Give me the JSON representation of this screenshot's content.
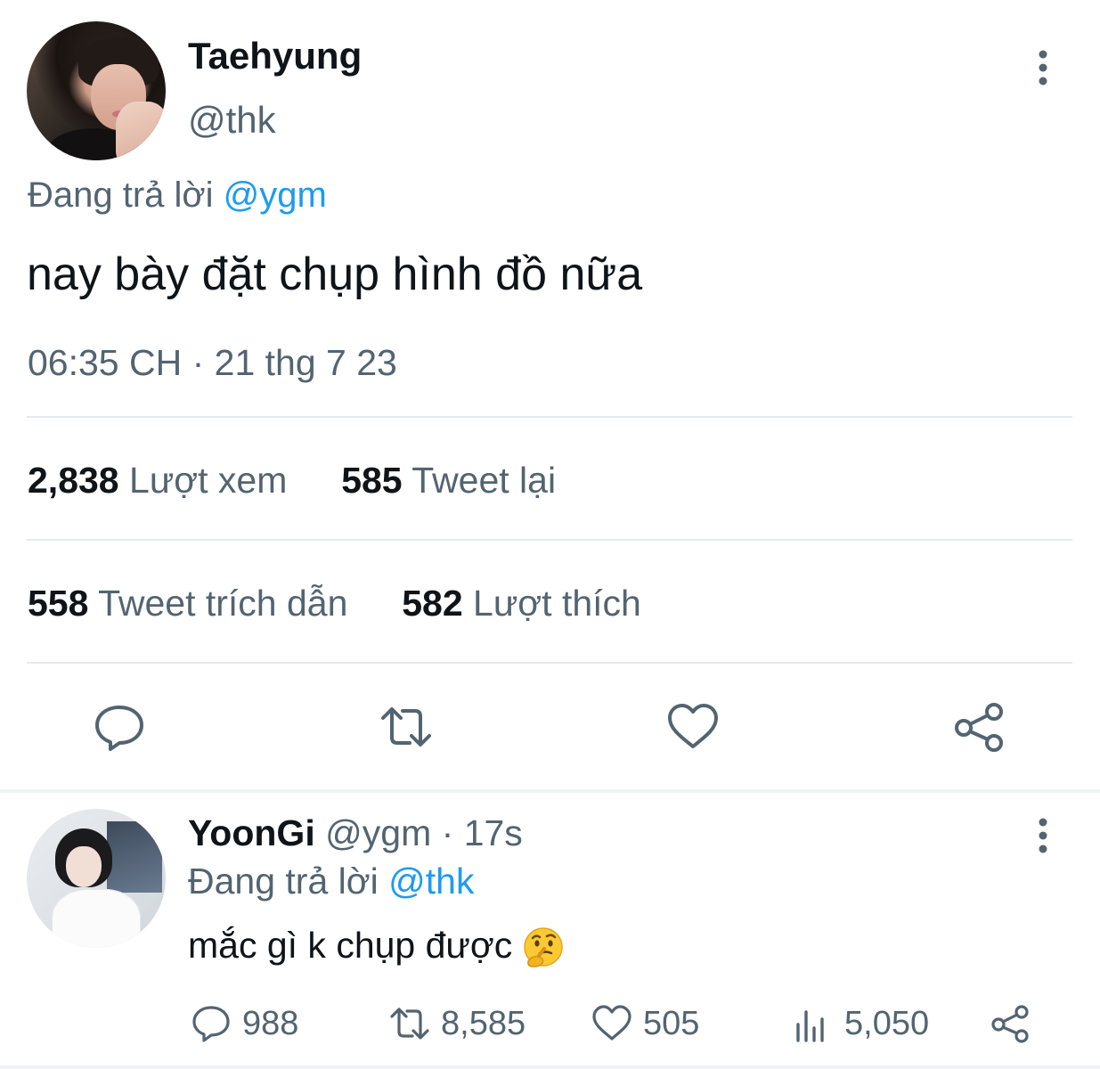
{
  "main_tweet": {
    "display_name": "Taehyung",
    "handle": "@thk",
    "reply_prefix": "Đang trả lời",
    "reply_to": "@ygm",
    "text": "nay bày đặt chụp hình đồ nữa",
    "timestamp": "06:35 CH · 21 thg 7 23",
    "stats": {
      "views_count": "2,838",
      "views_label": "Lượt xem",
      "retweets_count": "585",
      "retweets_label": "Tweet lại",
      "quotes_count": "558",
      "quotes_label": "Tweet trích dẫn",
      "likes_count": "582",
      "likes_label": "Lượt thích"
    },
    "actions": [
      "reply-icon",
      "retweet-icon",
      "like-icon",
      "share-icon"
    ]
  },
  "reply_tweet": {
    "display_name": "YoonGi",
    "handle": "@ygm",
    "separator": "·",
    "time": "17s",
    "reply_prefix": "Đang trả lời",
    "reply_to": "@thk",
    "text": "mắc gì k chụp được",
    "emoji": "thinking-face-emoji",
    "actions": {
      "replies": "988",
      "retweets": "8,585",
      "likes": "505",
      "views": "5,050"
    }
  },
  "colors": {
    "text_primary": "#0f1419",
    "text_secondary": "#536471",
    "link": "#1d9bf0",
    "divider": "#e6e9eb"
  }
}
